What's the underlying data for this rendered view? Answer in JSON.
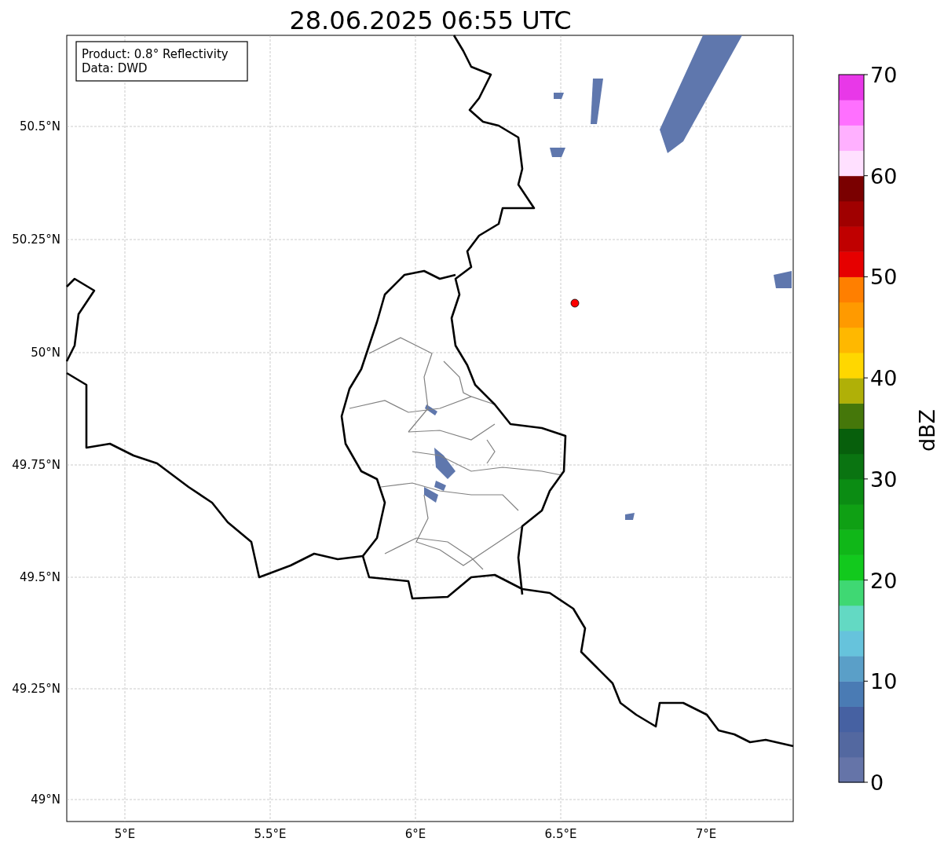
{
  "title": "28.06.2025 06:55 UTC",
  "info_box": {
    "lines": [
      "Product: 0.8° Reflectivity",
      "Data: DWD"
    ]
  },
  "map": {
    "lat_labels": [
      "50.5°N",
      "50.25°N",
      "50°N",
      "49.75°N",
      "49.5°N",
      "49.25°N",
      "49°N"
    ],
    "lon_labels": [
      "5°E",
      "5.5°E",
      "6°E",
      "6.5°E",
      "7°E"
    ]
  },
  "colorbar": {
    "label": "dBZ",
    "ticks": [
      "70",
      "60",
      "50",
      "40",
      "30",
      "20",
      "10",
      "0"
    ],
    "bins": [
      {
        "color": "#6574a8"
      },
      {
        "color": "#5368a0"
      },
      {
        "color": "#4661a2"
      },
      {
        "color": "#4a7bb4"
      },
      {
        "color": "#5a9fc8"
      },
      {
        "color": "#66c3dc"
      },
      {
        "color": "#63d9c3"
      },
      {
        "color": "#3fd873"
      },
      {
        "color": "#12c91d"
      },
      {
        "color": "#10b718"
      },
      {
        "color": "#0fa014"
      },
      {
        "color": "#0b8c13"
      },
      {
        "color": "#0a7411"
      },
      {
        "color": "#075f0c"
      },
      {
        "color": "#45770a"
      },
      {
        "color": "#b0b007"
      },
      {
        "color": "#ffd700"
      },
      {
        "color": "#ffb800"
      },
      {
        "color": "#ff9a00"
      },
      {
        "color": "#ff7f00"
      },
      {
        "color": "#e60000"
      },
      {
        "color": "#c00000"
      },
      {
        "color": "#a00000"
      },
      {
        "color": "#7a0000"
      },
      {
        "color": "#ffe0ff"
      },
      {
        "color": "#ffb0ff"
      },
      {
        "color": "#ff70ff"
      },
      {
        "color": "#e838e8"
      }
    ]
  }
}
